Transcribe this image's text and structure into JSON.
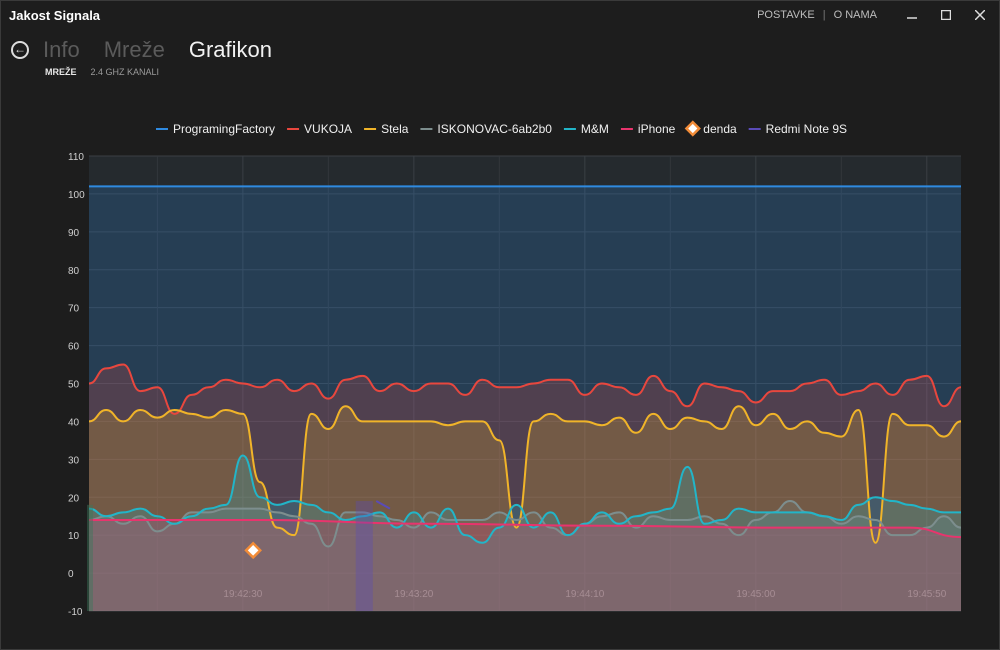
{
  "window": {
    "title": "Jakost Signala",
    "links": [
      "POSTAVKE",
      "O NAMA"
    ]
  },
  "nav": {
    "items": [
      "Info",
      "Mreže",
      "Grafikon"
    ],
    "active_index": 2,
    "sub_items": [
      "MREŽE",
      "2.4 GHZ KANALI"
    ]
  },
  "chart_data": {
    "type": "area",
    "ylim": [
      -10,
      110
    ],
    "y_ticks": [
      110,
      100,
      90,
      80,
      70,
      60,
      50,
      40,
      30,
      20,
      10,
      0,
      -10
    ],
    "xlim": [
      0,
      230
    ],
    "x_tick_labels": [
      {
        "t": 45,
        "label": "19:42:30"
      },
      {
        "t": 95,
        "label": "19:43:20"
      },
      {
        "t": 145,
        "label": "19:44:10"
      },
      {
        "t": 195,
        "label": "19:45:00"
      },
      {
        "t": 245,
        "label": "19:45:50"
      }
    ],
    "grid": true,
    "legend_position": "top",
    "series": [
      {
        "name": "ProgramingFactory",
        "color": "#2f8ae0",
        "x": [
          0,
          255
        ],
        "y": [
          102,
          102
        ]
      },
      {
        "name": "VUKOJA",
        "color": "#e8473e",
        "x": [
          0,
          5,
          10,
          15,
          20,
          25,
          30,
          35,
          40,
          45,
          50,
          55,
          60,
          65,
          70,
          75,
          80,
          85,
          90,
          95,
          100,
          105,
          110,
          115,
          120,
          125,
          130,
          135,
          140,
          145,
          150,
          155,
          160,
          165,
          170,
          175,
          180,
          185,
          190,
          195,
          200,
          205,
          210,
          215,
          220,
          225,
          230,
          235,
          240,
          245,
          250,
          255
        ],
        "y": [
          50,
          54,
          55,
          48,
          49,
          42,
          47,
          49,
          51,
          50,
          49,
          51,
          48,
          50,
          46,
          51,
          52,
          48,
          50,
          48,
          50,
          50,
          47,
          51,
          49,
          49,
          50,
          51,
          51,
          47,
          50,
          49,
          47,
          52,
          48,
          44,
          50,
          49,
          48,
          45,
          48,
          48,
          50,
          51,
          47,
          48,
          50,
          47,
          51,
          52,
          44,
          49
        ]
      },
      {
        "name": "Stela",
        "color": "#f0b429",
        "x": [
          0,
          5,
          10,
          15,
          20,
          25,
          30,
          35,
          40,
          45,
          50,
          55,
          60,
          65,
          70,
          75,
          80,
          85,
          90,
          95,
          100,
          105,
          110,
          115,
          120,
          125,
          130,
          135,
          140,
          145,
          150,
          155,
          160,
          165,
          170,
          175,
          180,
          185,
          190,
          195,
          200,
          205,
          210,
          215,
          220,
          225,
          230,
          235,
          240,
          245,
          250,
          255
        ],
        "y": [
          40,
          43,
          40,
          43,
          41,
          43,
          42,
          41,
          43,
          42,
          24,
          12,
          10,
          42,
          38,
          44,
          40,
          40,
          40,
          40,
          40,
          39,
          40,
          40,
          35,
          12,
          40,
          42,
          40,
          40,
          39,
          41,
          37,
          42,
          38,
          41,
          40,
          38,
          44,
          39,
          42,
          38,
          40,
          37,
          36,
          43,
          8,
          42,
          39,
          39,
          36,
          40
        ]
      },
      {
        "name": "ISKONOVAC-6ab2b0",
        "color": "#7d8e8e",
        "x": [
          0,
          5,
          10,
          15,
          20,
          25,
          30,
          35,
          40,
          45,
          50,
          55,
          60,
          65,
          70,
          75,
          80,
          85,
          90,
          95,
          100,
          105,
          110,
          115,
          120,
          125,
          130,
          135,
          140,
          145,
          150,
          155,
          160,
          165,
          170,
          175,
          180,
          185,
          190,
          195,
          200,
          205,
          210,
          215,
          220,
          225,
          230,
          235,
          240,
          245,
          250,
          255
        ],
        "y": [
          14,
          15,
          13,
          15,
          11,
          13,
          16,
          16,
          17,
          17,
          17,
          16,
          15,
          13,
          7,
          16,
          16,
          15,
          14,
          12,
          16,
          14,
          14,
          14,
          16,
          14,
          16,
          12,
          10,
          13,
          15,
          16,
          12,
          15,
          14,
          14,
          15,
          13,
          10,
          14,
          16,
          19,
          16,
          15,
          13,
          15,
          14,
          10,
          10,
          12,
          15,
          12
        ]
      },
      {
        "name": "M&M",
        "color": "#22b5c8",
        "x": [
          0,
          5,
          10,
          15,
          20,
          25,
          30,
          35,
          40,
          45,
          50,
          55,
          60,
          65,
          70,
          75,
          80,
          85,
          90,
          95,
          100,
          105,
          110,
          115,
          120,
          125,
          130,
          135,
          140,
          145,
          150,
          155,
          160,
          165,
          170,
          175,
          180,
          185,
          190,
          195,
          200,
          205,
          210,
          215,
          220,
          225,
          230,
          235,
          240,
          245,
          250,
          255
        ],
        "y": [
          17,
          15,
          16,
          17,
          15,
          13,
          15,
          17,
          18,
          31,
          20,
          18,
          19,
          18,
          16,
          14,
          15,
          16,
          12,
          16,
          12,
          17,
          10,
          8,
          12,
          18,
          12,
          16,
          10,
          13,
          16,
          13,
          15,
          16,
          17,
          28,
          13,
          14,
          17,
          16,
          16,
          16,
          16,
          15,
          14,
          18,
          20,
          19,
          18,
          17,
          16,
          16
        ]
      },
      {
        "name": "iPhone",
        "color": "#e8346d",
        "x": [
          0,
          50,
          100,
          150,
          200,
          240,
          255
        ],
        "y": [
          14,
          14,
          13,
          12.5,
          12,
          12,
          9.5
        ]
      },
      {
        "name": "denda",
        "color": "#f28c38",
        "x": [
          48
        ],
        "y": [
          6
        ]
      },
      {
        "name": "Redmi Note 9S",
        "color": "#5a4bb8",
        "x": [
          84,
          88
        ],
        "y": [
          19,
          17
        ]
      }
    ]
  }
}
